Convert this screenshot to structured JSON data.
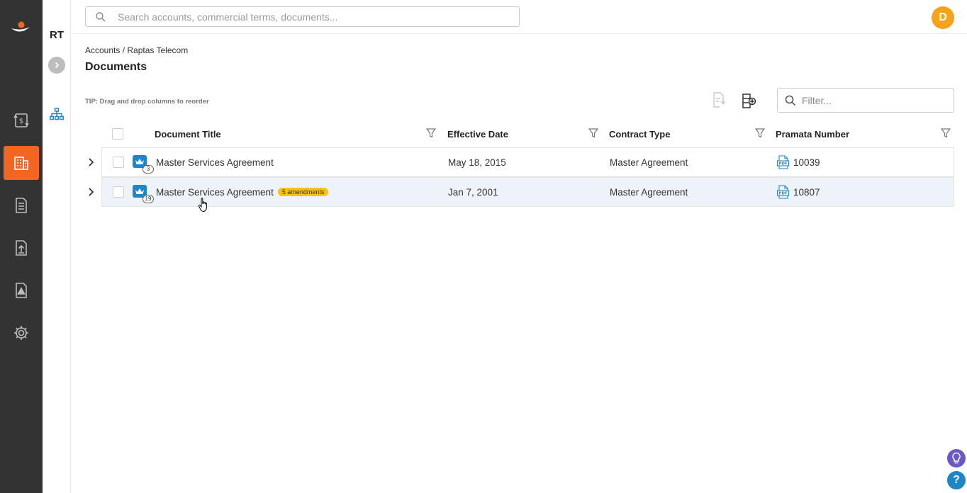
{
  "nav": {
    "items": [
      {
        "name": "logo-icon"
      },
      {
        "name": "billing-icon"
      },
      {
        "name": "accounts-icon",
        "active": true
      },
      {
        "name": "documents-icon"
      },
      {
        "name": "upload-icon"
      },
      {
        "name": "alerts-icon"
      },
      {
        "name": "settings-icon"
      }
    ],
    "active_color": "#f26522"
  },
  "subnav": {
    "initials": "RT"
  },
  "search": {
    "placeholder": "Search accounts, commercial terms, documents..."
  },
  "user": {
    "avatar_letter": "D",
    "avatar_color": "#f7a21b"
  },
  "breadcrumb": "Accounts / Raptas Telecom",
  "page_title": "Documents",
  "tip": "TIP: Drag and drop columns to reorder",
  "filter": {
    "placeholder": "Filter..."
  },
  "table": {
    "columns": [
      "Document Title",
      "Effective Date",
      "Contract Type",
      "Pramata Number"
    ],
    "rows": [
      {
        "badge_count": "3",
        "title": "Master Services Agreement",
        "amendments": "",
        "effective_date": "May 18, 2015",
        "contract_type": "Master Agreement",
        "pramata_number": "10039"
      },
      {
        "badge_count": "19",
        "title": "Master Services Agreement",
        "amendments": "5 amendments",
        "effective_date": "Jan 7, 2001",
        "contract_type": "Master Agreement",
        "pramata_number": "10807"
      }
    ]
  },
  "help": {
    "question_glyph": "?"
  }
}
